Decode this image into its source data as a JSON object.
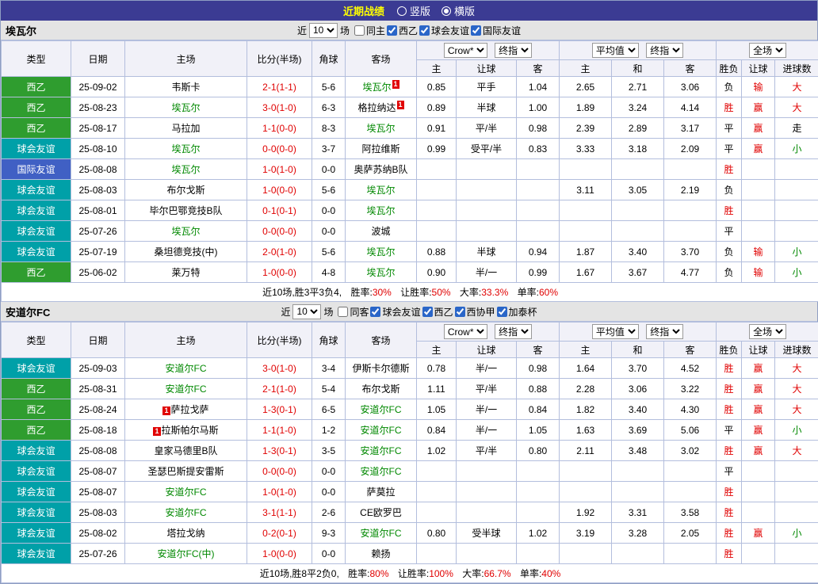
{
  "top_bar": {
    "title": "近期战绩",
    "radios": [
      {
        "label": "竖版",
        "selected": false
      },
      {
        "label": "横版",
        "selected": true
      }
    ]
  },
  "table_header": {
    "col_type": "类型",
    "col_date": "日期",
    "col_home": "主场",
    "col_score": "比分(半场)",
    "col_corner": "角球",
    "col_away": "客场",
    "dd_crown": "Crow*",
    "dd_final1": "终指",
    "dd_avg": "平均值",
    "dd_final2": "终指",
    "dd_fulltime": "全场",
    "sub_home": "主",
    "sub_handicap": "让球",
    "sub_away": "客",
    "sub_home2": "主",
    "sub_draw": "和",
    "sub_away2": "客",
    "col_result": "胜负",
    "col_handicap_result": "让球",
    "col_goals": "进球数"
  },
  "colors": {
    "league_es2": "#2f9d2f",
    "club_friendly": "#00a0a8",
    "intl_friendly": "#4060c4",
    "focus_team": "#008800",
    "score_red": "#e00000",
    "topbar_bg": "#3b3b93",
    "title_yellow": "#ffff00"
  },
  "sections": [
    {
      "team": "埃瓦尔",
      "filter": {
        "recent_label": "近",
        "count": "10",
        "games_label": "场",
        "same_label": "同主",
        "same_checked": false,
        "comps": [
          {
            "label": "西乙",
            "checked": true
          },
          {
            "label": "球会友谊",
            "checked": true
          },
          {
            "label": "国际友谊",
            "checked": true
          }
        ]
      },
      "rows": [
        {
          "type": "西乙",
          "type_key": "es2",
          "date": "25-09-02",
          "home": "韦斯卡",
          "home_key": "",
          "home_card": "",
          "score": "2-1(1-1)",
          "corners": "5-6",
          "away": "埃瓦尔",
          "away_key": "focus",
          "away_card": "1",
          "o1h": "0.85",
          "o1l": "平手",
          "o1a": "1.04",
          "o2h": "2.65",
          "o2d": "2.71",
          "o2a": "3.06",
          "res": "负",
          "res_key": "loss",
          "hand": "输",
          "hand_key": "red",
          "goal": "大",
          "goal_key": "big"
        },
        {
          "type": "西乙",
          "type_key": "es2",
          "date": "25-08-23",
          "home": "埃瓦尔",
          "home_key": "focus",
          "home_card": "",
          "score": "3-0(1-0)",
          "corners": "6-3",
          "away": "格拉纳达",
          "away_key": "",
          "away_card": "1",
          "o1h": "0.89",
          "o1l": "半球",
          "o1a": "1.00",
          "o2h": "1.89",
          "o2d": "3.24",
          "o2a": "4.14",
          "res": "胜",
          "res_key": "win",
          "hand": "赢",
          "hand_key": "red",
          "goal": "大",
          "goal_key": "big"
        },
        {
          "type": "西乙",
          "type_key": "es2",
          "date": "25-08-17",
          "home": "马拉加",
          "home_key": "",
          "home_card": "",
          "score": "1-1(0-0)",
          "corners": "8-3",
          "away": "埃瓦尔",
          "away_key": "focus",
          "away_card": "",
          "o1h": "0.91",
          "o1l": "平/半",
          "o1a": "0.98",
          "o2h": "2.39",
          "o2d": "2.89",
          "o2a": "3.17",
          "res": "平",
          "res_key": "draw",
          "hand": "赢",
          "hand_key": "red",
          "goal": "走",
          "goal_key": ""
        },
        {
          "type": "球会友谊",
          "type_key": "friendly",
          "date": "25-08-10",
          "home": "埃瓦尔",
          "home_key": "focus",
          "home_card": "",
          "score": "0-0(0-0)",
          "corners": "3-7",
          "away": "阿拉维斯",
          "away_key": "",
          "away_card": "",
          "o1h": "0.99",
          "o1l": "受平/半",
          "o1a": "0.83",
          "o2h": "3.33",
          "o2d": "3.18",
          "o2a": "2.09",
          "res": "平",
          "res_key": "draw",
          "hand": "赢",
          "hand_key": "red",
          "goal": "小",
          "goal_key": "small"
        },
        {
          "type": "国际友谊",
          "type_key": "intl",
          "date": "25-08-08",
          "home": "埃瓦尔",
          "home_key": "focus",
          "home_card": "",
          "score": "1-0(1-0)",
          "corners": "0-0",
          "away": "奥萨苏纳B队",
          "away_key": "",
          "away_card": "",
          "o1h": "",
          "o1l": "",
          "o1a": "",
          "o2h": "",
          "o2d": "",
          "o2a": "",
          "res": "胜",
          "res_key": "win",
          "hand": "",
          "hand_key": "",
          "goal": "",
          "goal_key": ""
        },
        {
          "type": "球会友谊",
          "type_key": "friendly",
          "date": "25-08-03",
          "home": "布尔戈斯",
          "home_key": "",
          "home_card": "",
          "score": "1-0(0-0)",
          "corners": "5-6",
          "away": "埃瓦尔",
          "away_key": "focus",
          "away_card": "",
          "o1h": "",
          "o1l": "",
          "o1a": "",
          "o2h": "3.11",
          "o2d": "3.05",
          "o2a": "2.19",
          "res": "负",
          "res_key": "loss",
          "hand": "",
          "hand_key": "",
          "goal": "",
          "goal_key": ""
        },
        {
          "type": "球会友谊",
          "type_key": "friendly",
          "date": "25-08-01",
          "home": "毕尔巴鄂竞技B队",
          "home_key": "",
          "home_card": "",
          "score": "0-1(0-1)",
          "corners": "0-0",
          "away": "埃瓦尔",
          "away_key": "focus",
          "away_card": "",
          "o1h": "",
          "o1l": "",
          "o1a": "",
          "o2h": "",
          "o2d": "",
          "o2a": "",
          "res": "胜",
          "res_key": "win",
          "hand": "",
          "hand_key": "",
          "goal": "",
          "goal_key": ""
        },
        {
          "type": "球会友谊",
          "type_key": "friendly",
          "date": "25-07-26",
          "home": "埃瓦尔",
          "home_key": "focus",
          "home_card": "",
          "score": "0-0(0-0)",
          "corners": "0-0",
          "away": "波城",
          "away_key": "",
          "away_card": "",
          "o1h": "",
          "o1l": "",
          "o1a": "",
          "o2h": "",
          "o2d": "",
          "o2a": "",
          "res": "平",
          "res_key": "draw",
          "hand": "",
          "hand_key": "",
          "goal": "",
          "goal_key": ""
        },
        {
          "type": "球会友谊",
          "type_key": "friendly",
          "date": "25-07-19",
          "home": "桑坦德竞技(中)",
          "home_key": "",
          "home_card": "",
          "score": "2-0(1-0)",
          "corners": "5-6",
          "away": "埃瓦尔",
          "away_key": "focus",
          "away_card": "",
          "o1h": "0.88",
          "o1l": "半球",
          "o1a": "0.94",
          "o2h": "1.87",
          "o2d": "3.40",
          "o2a": "3.70",
          "res": "负",
          "res_key": "loss",
          "hand": "输",
          "hand_key": "red",
          "goal": "小",
          "goal_key": "small"
        },
        {
          "type": "西乙",
          "type_key": "es2",
          "date": "25-06-02",
          "home": "莱万特",
          "home_key": "",
          "home_card": "",
          "score": "1-0(0-0)",
          "corners": "4-8",
          "away": "埃瓦尔",
          "away_key": "focus",
          "away_card": "",
          "o1h": "0.90",
          "o1l": "半/一",
          "o1a": "0.99",
          "o2h": "1.67",
          "o2d": "3.67",
          "o2a": "4.77",
          "res": "负",
          "res_key": "loss",
          "hand": "输",
          "hand_key": "red",
          "goal": "小",
          "goal_key": "small"
        }
      ],
      "summary": {
        "prefix": "近10场,胜3平3负4,",
        "stats": [
          {
            "label": "胜率:",
            "value": "30%"
          },
          {
            "label": "让胜率:",
            "value": "50%"
          },
          {
            "label": "大率:",
            "value": "33.3%"
          },
          {
            "label": "单率:",
            "value": "60%"
          }
        ]
      }
    },
    {
      "team": "安道尔FC",
      "filter": {
        "recent_label": "近",
        "count": "10",
        "games_label": "场",
        "same_label": "同客",
        "same_checked": false,
        "comps": [
          {
            "label": "球会友谊",
            "checked": true
          },
          {
            "label": "西乙",
            "checked": true
          },
          {
            "label": "西协甲",
            "checked": true
          },
          {
            "label": "加泰杯",
            "checked": true
          }
        ]
      },
      "rows": [
        {
          "type": "球会友谊",
          "type_key": "friendly",
          "date": "25-09-03",
          "home": "安道尔FC",
          "home_key": "focus",
          "home_card": "",
          "score": "3-0(1-0)",
          "corners": "3-4",
          "away": "伊斯卡尔德斯",
          "away_key": "",
          "away_card": "",
          "o1h": "0.78",
          "o1l": "半/一",
          "o1a": "0.98",
          "o2h": "1.64",
          "o2d": "3.70",
          "o2a": "4.52",
          "res": "胜",
          "res_key": "win",
          "hand": "赢",
          "hand_key": "red",
          "goal": "大",
          "goal_key": "big"
        },
        {
          "type": "西乙",
          "type_key": "es2",
          "date": "25-08-31",
          "home": "安道尔FC",
          "home_key": "focus",
          "home_card": "",
          "score": "2-1(1-0)",
          "corners": "5-4",
          "away": "布尔戈斯",
          "away_key": "",
          "away_card": "",
          "o1h": "1.11",
          "o1l": "平/半",
          "o1a": "0.88",
          "o2h": "2.28",
          "o2d": "3.06",
          "o2a": "3.22",
          "res": "胜",
          "res_key": "win",
          "hand": "赢",
          "hand_key": "red",
          "goal": "大",
          "goal_key": "big"
        },
        {
          "type": "西乙",
          "type_key": "es2",
          "date": "25-08-24",
          "home": "萨拉戈萨",
          "home_key": "",
          "home_card": "1",
          "score": "1-3(0-1)",
          "corners": "6-5",
          "away": "安道尔FC",
          "away_key": "focus",
          "away_card": "",
          "o1h": "1.05",
          "o1l": "半/一",
          "o1a": "0.84",
          "o2h": "1.82",
          "o2d": "3.40",
          "o2a": "4.30",
          "res": "胜",
          "res_key": "win",
          "hand": "赢",
          "hand_key": "red",
          "goal": "大",
          "goal_key": "big"
        },
        {
          "type": "西乙",
          "type_key": "es2",
          "date": "25-08-18",
          "home": "拉斯帕尔马斯",
          "home_key": "",
          "home_card": "1",
          "score": "1-1(1-0)",
          "corners": "1-2",
          "away": "安道尔FC",
          "away_key": "focus",
          "away_card": "",
          "o1h": "0.84",
          "o1l": "半/一",
          "o1a": "1.05",
          "o2h": "1.63",
          "o2d": "3.69",
          "o2a": "5.06",
          "res": "平",
          "res_key": "draw",
          "hand": "赢",
          "hand_key": "red",
          "goal": "小",
          "goal_key": "small"
        },
        {
          "type": "球会友谊",
          "type_key": "friendly",
          "date": "25-08-08",
          "home": "皇家马德里B队",
          "home_key": "",
          "home_card": "",
          "score": "1-3(0-1)",
          "corners": "3-5",
          "away": "安道尔FC",
          "away_key": "focus",
          "away_card": "",
          "o1h": "1.02",
          "o1l": "平/半",
          "o1a": "0.80",
          "o2h": "2.11",
          "o2d": "3.48",
          "o2a": "3.02",
          "res": "胜",
          "res_key": "win",
          "hand": "赢",
          "hand_key": "red",
          "goal": "大",
          "goal_key": "big"
        },
        {
          "type": "球会友谊",
          "type_key": "friendly",
          "date": "25-08-07",
          "home": "圣瑟巴斯提安雷斯",
          "home_key": "",
          "home_card": "",
          "score": "0-0(0-0)",
          "corners": "0-0",
          "away": "安道尔FC",
          "away_key": "focus",
          "away_card": "",
          "o1h": "",
          "o1l": "",
          "o1a": "",
          "o2h": "",
          "o2d": "",
          "o2a": "",
          "res": "平",
          "res_key": "draw",
          "hand": "",
          "hand_key": "",
          "goal": "",
          "goal_key": ""
        },
        {
          "type": "球会友谊",
          "type_key": "friendly",
          "date": "25-08-07",
          "home": "安道尔FC",
          "home_key": "focus",
          "home_card": "",
          "score": "1-0(1-0)",
          "corners": "0-0",
          "away": "萨莫拉",
          "away_key": "",
          "away_card": "",
          "o1h": "",
          "o1l": "",
          "o1a": "",
          "o2h": "",
          "o2d": "",
          "o2a": "",
          "res": "胜",
          "res_key": "win",
          "hand": "",
          "hand_key": "",
          "goal": "",
          "goal_key": ""
        },
        {
          "type": "球会友谊",
          "type_key": "friendly",
          "date": "25-08-03",
          "home": "安道尔FC",
          "home_key": "focus",
          "home_card": "",
          "score": "3-1(1-1)",
          "corners": "2-6",
          "away": "CE欧罗巴",
          "away_key": "",
          "away_card": "",
          "o1h": "",
          "o1l": "",
          "o1a": "",
          "o2h": "1.92",
          "o2d": "3.31",
          "o2a": "3.58",
          "res": "胜",
          "res_key": "win",
          "hand": "",
          "hand_key": "",
          "goal": "",
          "goal_key": ""
        },
        {
          "type": "球会友谊",
          "type_key": "friendly",
          "date": "25-08-02",
          "home": "塔拉戈纳",
          "home_key": "",
          "home_card": "",
          "score": "0-2(0-1)",
          "corners": "9-3",
          "away": "安道尔FC",
          "away_key": "focus",
          "away_card": "",
          "o1h": "0.80",
          "o1l": "受半球",
          "o1a": "1.02",
          "o2h": "3.19",
          "o2d": "3.28",
          "o2a": "2.05",
          "res": "胜",
          "res_key": "win",
          "hand": "赢",
          "hand_key": "red",
          "goal": "小",
          "goal_key": "small"
        },
        {
          "type": "球会友谊",
          "type_key": "friendly",
          "date": "25-07-26",
          "home": "安道尔FC(中)",
          "home_key": "focus",
          "home_card": "",
          "score": "1-0(0-0)",
          "corners": "0-0",
          "away": "赖扬",
          "away_key": "",
          "away_card": "",
          "o1h": "",
          "o1l": "",
          "o1a": "",
          "o2h": "",
          "o2d": "",
          "o2a": "",
          "res": "胜",
          "res_key": "win",
          "hand": "",
          "hand_key": "",
          "goal": "",
          "goal_key": ""
        }
      ],
      "summary": {
        "prefix": "近10场,胜8平2负0,",
        "stats": [
          {
            "label": "胜率:",
            "value": "80%"
          },
          {
            "label": "让胜率:",
            "value": "100%"
          },
          {
            "label": "大率:",
            "value": "66.7%"
          },
          {
            "label": "单率:",
            "value": "40%"
          }
        ]
      }
    }
  ]
}
